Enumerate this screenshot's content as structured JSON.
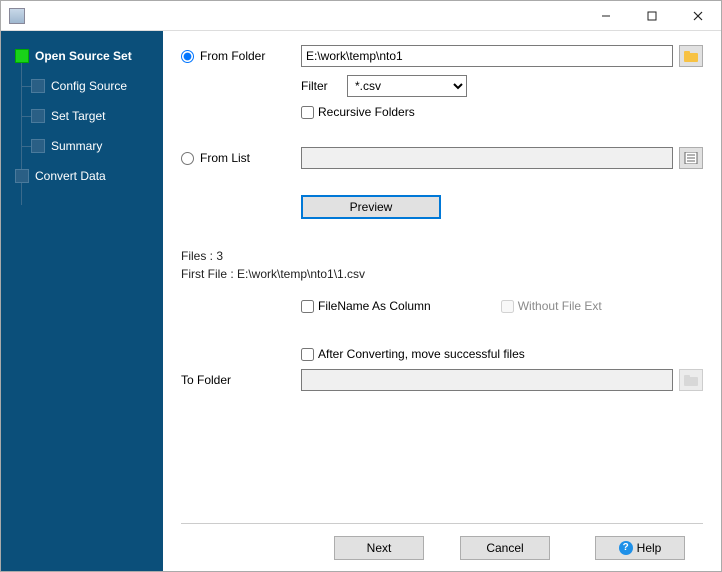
{
  "titlebar": {
    "title": ""
  },
  "sidebar": {
    "items": [
      {
        "label": "Open Source Set"
      },
      {
        "label": "Config Source"
      },
      {
        "label": "Set Target"
      },
      {
        "label": "Summary"
      },
      {
        "label": "Convert Data"
      }
    ]
  },
  "form": {
    "fromFolder": {
      "radioLabel": "From Folder",
      "value": "E:\\work\\temp\\nto1"
    },
    "filter": {
      "label": "Filter",
      "value": "*.csv"
    },
    "recursive": {
      "label": "Recursive Folders"
    },
    "fromList": {
      "radioLabel": "From List",
      "value": ""
    },
    "previewBtn": "Preview",
    "filesCount": "Files : 3",
    "firstFile": "First File : E:\\work\\temp\\nto1\\1.csv",
    "filenameAsColumn": {
      "label": "FileName As Column"
    },
    "withoutExt": {
      "label": "Without File Ext"
    },
    "afterConvert": {
      "label": "After Converting, move successful files"
    },
    "toFolder": {
      "label": "To Folder",
      "value": ""
    }
  },
  "footer": {
    "next": "Next",
    "cancel": "Cancel",
    "help": "Help"
  }
}
